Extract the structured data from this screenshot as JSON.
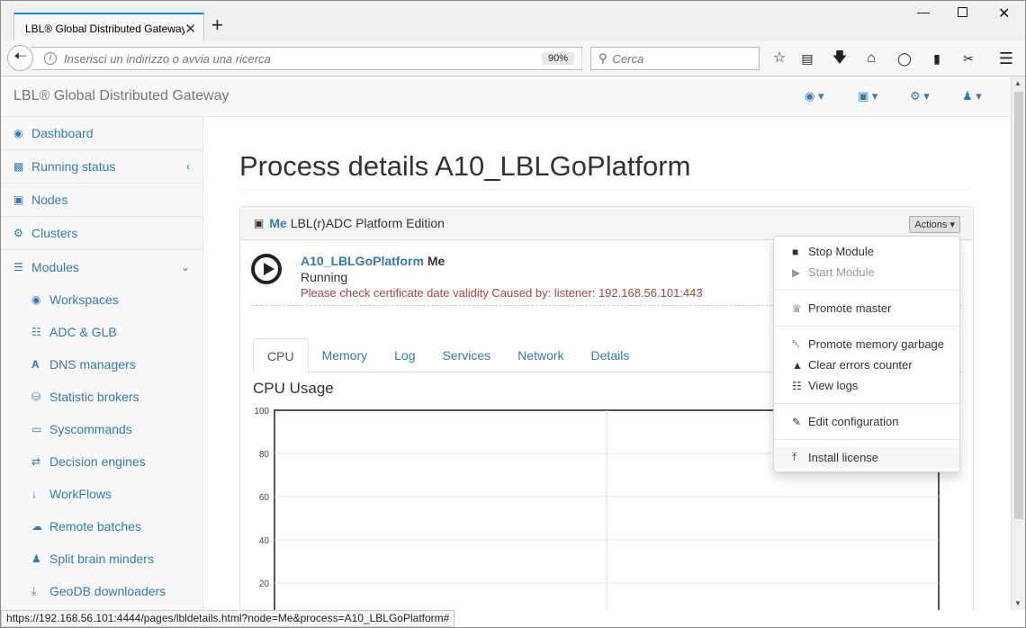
{
  "browser": {
    "tab_title": "LBL® Global Distributed Gateway",
    "tab_close": "✕",
    "new_tab": "+",
    "url_placeholder": "Inserisci un indirizzo o avvia una ricerca",
    "zoom": "90%",
    "search_placeholder": "Cerca",
    "status_url": "https://192.168.56.101:4444/pages/lbldetails.html?node=Me&process=A10_LBLGoPlatform#"
  },
  "app": {
    "brand": "LBL® Global Distributed Gateway"
  },
  "sidebar": {
    "items": [
      {
        "label": "Dashboard",
        "icon": "dashboard-icon"
      },
      {
        "label": "Running status",
        "icon": "bar-chart-icon"
      },
      {
        "label": "Nodes",
        "icon": "cube-icon"
      },
      {
        "label": "Clusters",
        "icon": "cogs-icon"
      },
      {
        "label": "Modules",
        "icon": "list-icon"
      }
    ],
    "subitems": [
      {
        "label": "Workspaces",
        "icon": "dashboard-icon"
      },
      {
        "label": "ADC & GLB",
        "icon": "sitemap-icon"
      },
      {
        "label": "DNS managers",
        "icon": "font-icon"
      },
      {
        "label": "Statistic brokers",
        "icon": "database-icon"
      },
      {
        "label": "Syscommands",
        "icon": "laptop-icon"
      },
      {
        "label": "Decision engines",
        "icon": "random-icon"
      },
      {
        "label": "WorkFlows",
        "icon": "sort-numeric-icon"
      },
      {
        "label": "Remote batches",
        "icon": "cloud-upload-icon"
      },
      {
        "label": "Split brain minders",
        "icon": "users-icon"
      },
      {
        "label": "GeoDB downloaders",
        "icon": "download-icon"
      }
    ]
  },
  "main": {
    "title": "Process details A10_LBLGoPlatform",
    "panel": {
      "node": "Me",
      "edition": "LBL(r)ADC Platform Edition",
      "actions_label": "Actions"
    },
    "process": {
      "name": "A10_LBLGoPlatform",
      "node": "Me",
      "status": "Running",
      "warning": "Please check certificate date validity Caused by: listener: 192.168.56.101:443"
    },
    "tabs": [
      "CPU",
      "Memory",
      "Log",
      "Services",
      "Network",
      "Details"
    ],
    "cpu_title": "CPU Usage"
  },
  "chart_data": {
    "type": "line",
    "title": "CPU Usage",
    "ylim": [
      0,
      100
    ],
    "yticks": [
      "100",
      "80",
      "60",
      "40",
      "20"
    ],
    "series": [],
    "grid": true
  },
  "actions_menu": {
    "groups": [
      [
        {
          "label": "Stop Module",
          "icon": "stop-icon",
          "disabled": false
        },
        {
          "label": "Start Module",
          "icon": "play-icon",
          "disabled": true
        }
      ],
      [
        {
          "label": "Promote master",
          "icon": "trophy-icon",
          "disabled": false
        }
      ],
      [
        {
          "label": "Promote memory garbage",
          "icon": "trash-icon",
          "disabled": false
        },
        {
          "label": "Clear errors counter",
          "icon": "warning-icon",
          "disabled": false
        },
        {
          "label": "View logs",
          "icon": "file-text-icon",
          "disabled": false
        }
      ],
      [
        {
          "label": "Edit configuration",
          "icon": "edit-icon",
          "disabled": false
        }
      ],
      [
        {
          "label": "Install license",
          "icon": "upload-icon",
          "disabled": false
        }
      ]
    ]
  }
}
